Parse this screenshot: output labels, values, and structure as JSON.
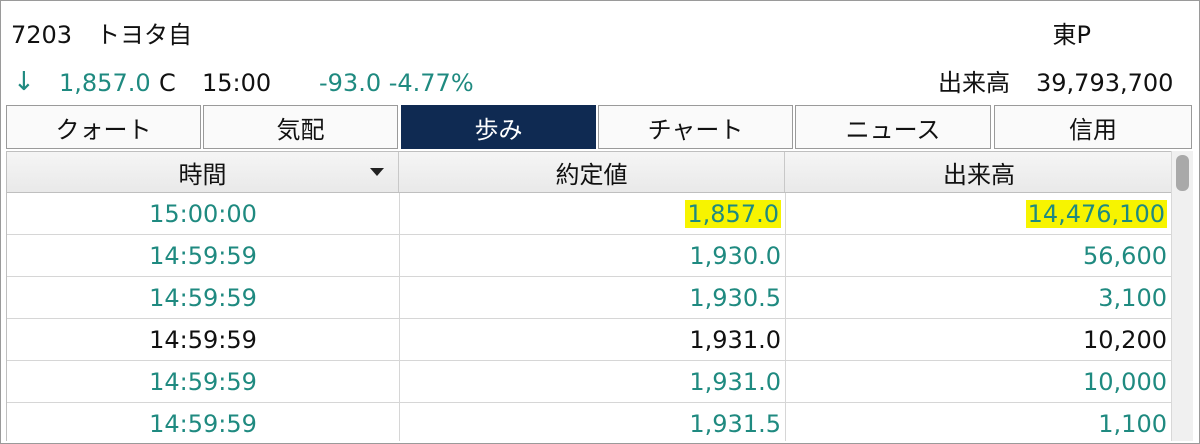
{
  "header": {
    "code": "7203",
    "name": "トヨタ自",
    "market": "東P",
    "direction_arrow": "↓",
    "price": "1,857.0",
    "price_flag": "C",
    "price_time": "15:00",
    "change": "-93.0 -4.77%",
    "volume_label": "出来高",
    "volume_value": "39,793,700"
  },
  "tabs": [
    {
      "label": "クォート",
      "active": false
    },
    {
      "label": "気配",
      "active": false
    },
    {
      "label": "歩み",
      "active": true
    },
    {
      "label": "チャート",
      "active": false
    },
    {
      "label": "ニュース",
      "active": false
    },
    {
      "label": "信用",
      "active": false
    }
  ],
  "table": {
    "columns": [
      "時間",
      "約定値",
      "出来高"
    ],
    "rows": [
      {
        "time": "15:00:00",
        "price": "1,857.0",
        "volume": "14,476,100",
        "color": "#1f8a80",
        "highlight": true
      },
      {
        "time": "14:59:59",
        "price": "1,930.0",
        "volume": "56,600",
        "color": "#1f8a80",
        "highlight": false
      },
      {
        "time": "14:59:59",
        "price": "1,930.5",
        "volume": "3,100",
        "color": "#1f8a80",
        "highlight": false
      },
      {
        "time": "14:59:59",
        "price": "1,931.0",
        "volume": "10,200",
        "color": "#111111",
        "highlight": false
      },
      {
        "time": "14:59:59",
        "price": "1,931.0",
        "volume": "10,000",
        "color": "#1f8a80",
        "highlight": false
      },
      {
        "time": "14:59:59",
        "price": "1,931.5",
        "volume": "1,100",
        "color": "#1f8a80",
        "highlight": false
      }
    ]
  },
  "colors": {
    "down": "#1f8a80",
    "neutral": "#111111",
    "active_tab": "#0f2a52",
    "highlight": "#f7f400"
  },
  "icons": {
    "sort": "sort-desc-icon",
    "direction": "down-arrow-icon"
  }
}
